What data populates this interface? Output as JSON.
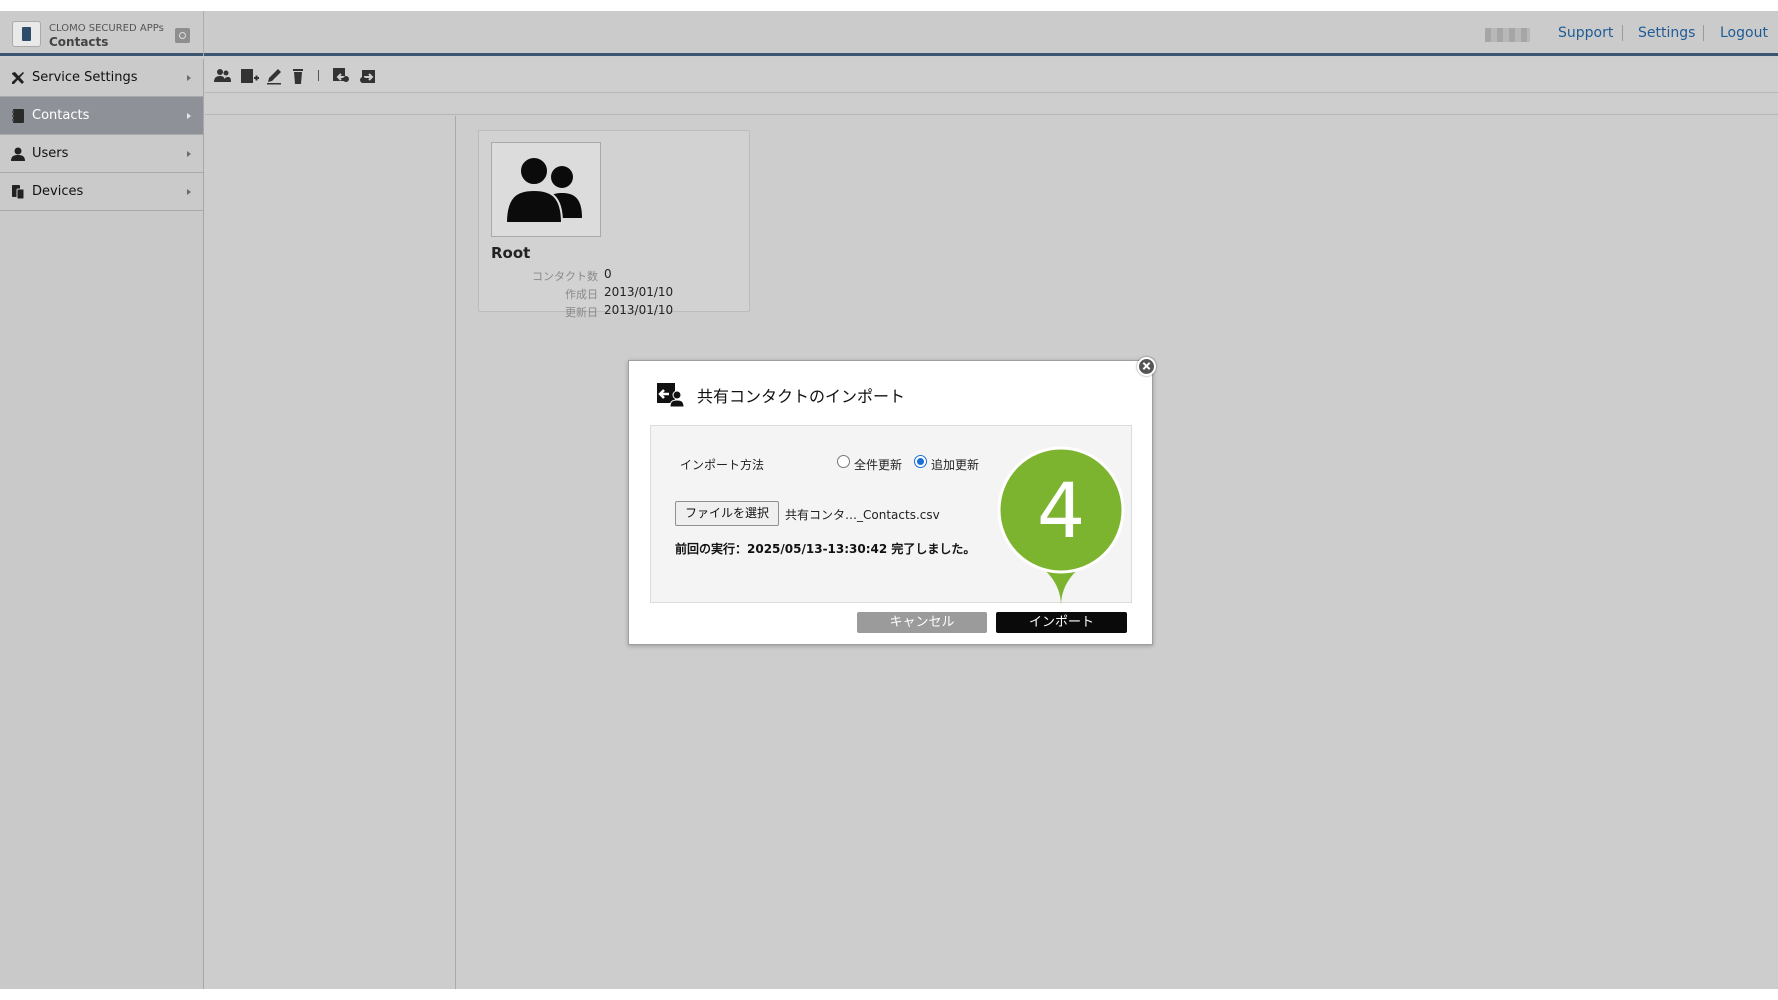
{
  "app": {
    "vendor": "CLOMO SECURED APPs",
    "name": "Contacts"
  },
  "header": {
    "links": {
      "support": "Support",
      "settings": "Settings",
      "logout": "Logout"
    }
  },
  "sidebar": {
    "items": [
      {
        "label": "Service Settings",
        "icon": "tools-icon",
        "active": false
      },
      {
        "label": "Contacts",
        "icon": "contacts-book-icon",
        "active": true
      },
      {
        "label": "Users",
        "icon": "user-icon",
        "active": false
      },
      {
        "label": "Devices",
        "icon": "devices-icon",
        "active": false
      }
    ]
  },
  "toolbar": {
    "buttons": [
      "add-group-icon",
      "add-contact-icon",
      "edit-icon",
      "delete-icon",
      "import-icon",
      "export-icon"
    ]
  },
  "group_card": {
    "name": "Root",
    "rows": [
      {
        "label": "コンタクト数",
        "value": "0"
      },
      {
        "label": "作成日",
        "value": "2013/01/10"
      },
      {
        "label": "更新日",
        "value": "2013/01/10"
      }
    ]
  },
  "dialog": {
    "title": "共有コンタクトのインポート",
    "method_label": "インポート方法",
    "options": [
      {
        "label": "全件更新",
        "checked": false
      },
      {
        "label": "追加更新",
        "checked": true
      }
    ],
    "file_button": "ファイルを選択",
    "file_name": "共有コンタ…_Contacts.csv",
    "last_run": "前回の実行：2025/05/13-13:30:42 完了しました。",
    "cancel_label": "キャンセル",
    "import_label": "インポート"
  },
  "step_marker": {
    "number": "4",
    "color": "#7db42f"
  },
  "colors": {
    "header_accent": "#3c5570",
    "link": "#1f5c96",
    "radio_selected": "#1a6fd6"
  }
}
